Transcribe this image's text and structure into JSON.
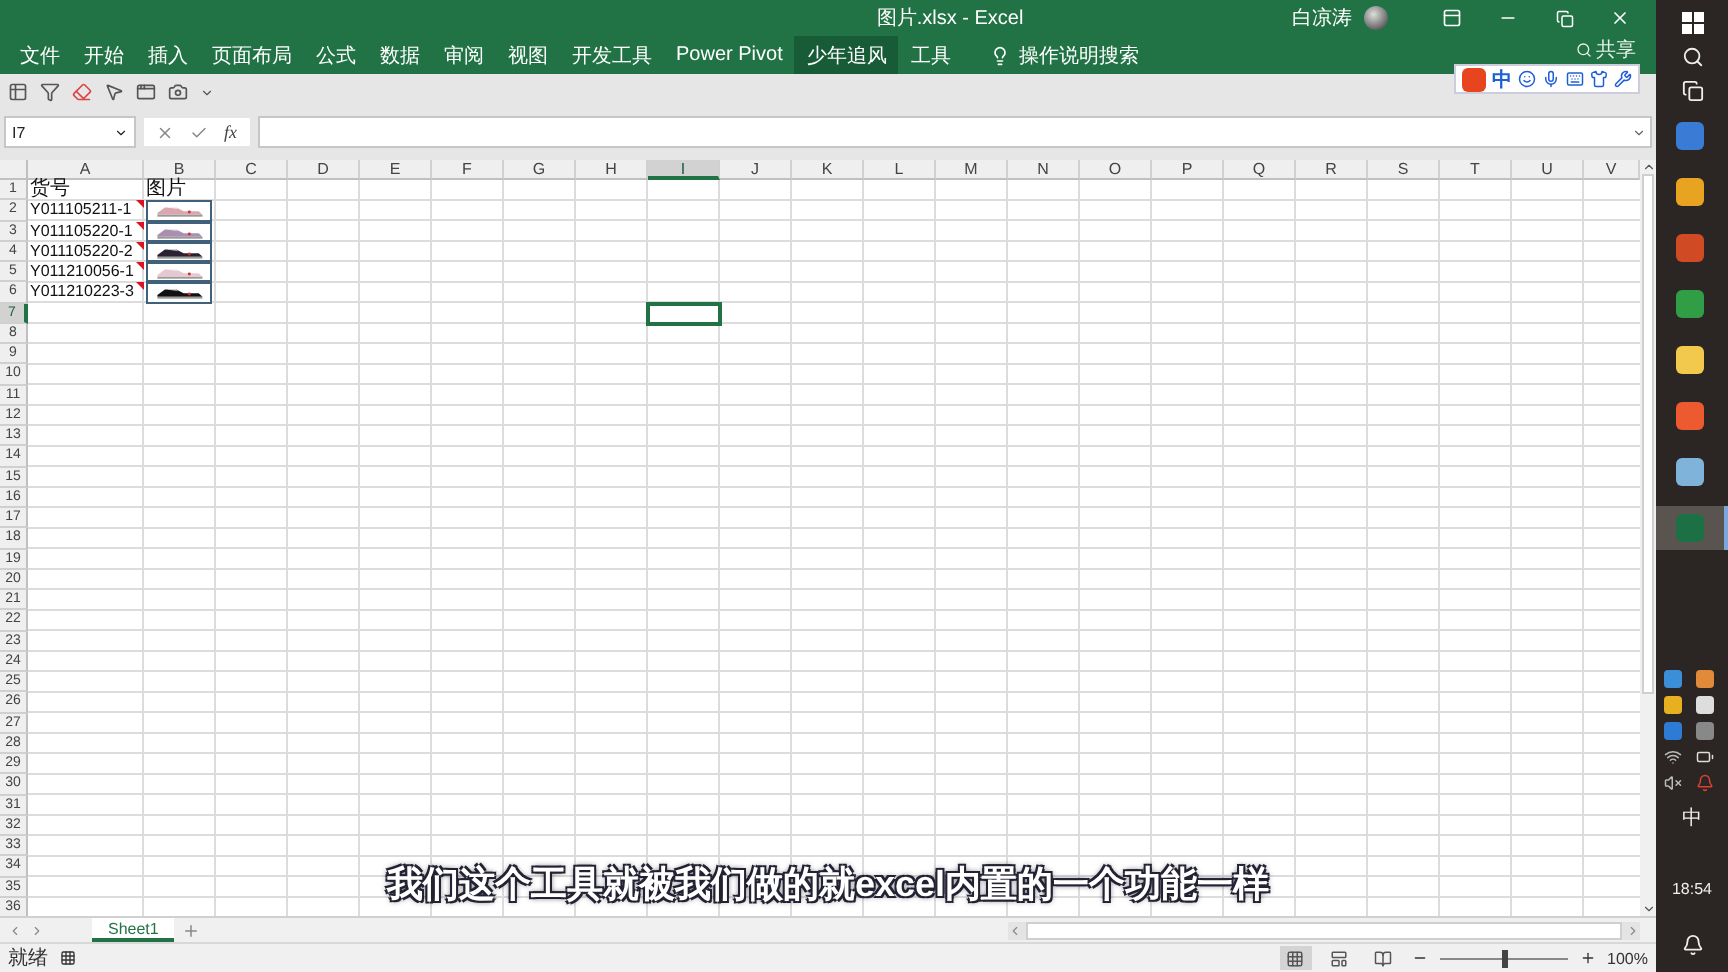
{
  "title_bar": {
    "title": "图片.xlsx  -  Excel",
    "user": "白凉涛"
  },
  "ribbon_tabs": [
    {
      "label": "文件",
      "selected": false
    },
    {
      "label": "开始",
      "selected": false
    },
    {
      "label": "插入",
      "selected": false
    },
    {
      "label": "页面布局",
      "selected": false
    },
    {
      "label": "公式",
      "selected": false
    },
    {
      "label": "数据",
      "selected": false
    },
    {
      "label": "审阅",
      "selected": false
    },
    {
      "label": "视图",
      "selected": false
    },
    {
      "label": "开发工具",
      "selected": false
    },
    {
      "label": "Power Pivot",
      "selected": false
    },
    {
      "label": "少年追风",
      "selected": true
    },
    {
      "label": "工具",
      "selected": false
    }
  ],
  "search_hint": "操作说明搜索",
  "share": "共享",
  "ime_toolbar": {
    "mode": "中"
  },
  "formula_bar": {
    "name_box": "I7",
    "function_button": "fx"
  },
  "sheet": {
    "columns": [
      {
        "label": "A",
        "selected": false
      },
      {
        "label": "B",
        "selected": false
      },
      {
        "label": "C",
        "selected": false
      },
      {
        "label": "D",
        "selected": false
      },
      {
        "label": "E",
        "selected": false
      },
      {
        "label": "F",
        "selected": false
      },
      {
        "label": "G",
        "selected": false
      },
      {
        "label": "H",
        "selected": false
      },
      {
        "label": "I",
        "selected": true
      },
      {
        "label": "J",
        "selected": false
      },
      {
        "label": "K",
        "selected": false
      },
      {
        "label": "L",
        "selected": false
      },
      {
        "label": "M",
        "selected": false
      },
      {
        "label": "N",
        "selected": false
      },
      {
        "label": "O",
        "selected": false
      },
      {
        "label": "P",
        "selected": false
      },
      {
        "label": "Q",
        "selected": false
      },
      {
        "label": "R",
        "selected": false
      },
      {
        "label": "S",
        "selected": false
      },
      {
        "label": "T",
        "selected": false
      },
      {
        "label": "U",
        "selected": false
      },
      {
        "label": "V",
        "selected": false
      }
    ],
    "rows": [
      {
        "label": "1",
        "selected": false,
        "cells": [
          {
            "kind": "text",
            "text": "货号",
            "has_comment": false
          },
          {
            "kind": "text",
            "text": "图片",
            "has_comment": false
          }
        ]
      },
      {
        "label": "2",
        "selected": false,
        "cells": [
          {
            "kind": "text",
            "text": "Y011105211-1",
            "has_comment": true
          },
          {
            "kind": "picture"
          }
        ]
      },
      {
        "label": "3",
        "selected": false,
        "cells": [
          {
            "kind": "text",
            "text": "Y011105220-1",
            "has_comment": true
          },
          {
            "kind": "picture"
          }
        ]
      },
      {
        "label": "4",
        "selected": false,
        "cells": [
          {
            "kind": "text",
            "text": "Y011105220-2",
            "has_comment": true
          },
          {
            "kind": "picture"
          }
        ]
      },
      {
        "label": "5",
        "selected": false,
        "cells": [
          {
            "kind": "text",
            "text": "Y011210056-1",
            "has_comment": true
          },
          {
            "kind": "picture"
          }
        ]
      },
      {
        "label": "6",
        "selected": false,
        "cells": [
          {
            "kind": "text",
            "text": "Y011210223-3",
            "has_comment": true
          },
          {
            "kind": "picture"
          }
        ]
      },
      {
        "label": "7",
        "selected": true
      },
      {
        "label": "8",
        "selected": false
      },
      {
        "label": "9",
        "selected": false
      },
      {
        "label": "10",
        "selected": false
      },
      {
        "label": "11",
        "selected": false
      },
      {
        "label": "12",
        "selected": false
      },
      {
        "label": "13",
        "selected": false
      },
      {
        "label": "14",
        "selected": false
      },
      {
        "label": "15",
        "selected": false
      },
      {
        "label": "16",
        "selected": false
      },
      {
        "label": "17",
        "selected": false
      },
      {
        "label": "18",
        "selected": false
      },
      {
        "label": "19",
        "selected": false
      },
      {
        "label": "20",
        "selected": false
      },
      {
        "label": "21",
        "selected": false
      },
      {
        "label": "22",
        "selected": false
      },
      {
        "label": "23",
        "selected": false
      },
      {
        "label": "24",
        "selected": false
      },
      {
        "label": "25",
        "selected": false
      },
      {
        "label": "26",
        "selected": false
      },
      {
        "label": "27",
        "selected": false
      },
      {
        "label": "28",
        "selected": false
      },
      {
        "label": "29",
        "selected": false
      },
      {
        "label": "30",
        "selected": false
      },
      {
        "label": "31",
        "selected": false
      },
      {
        "label": "32",
        "selected": false
      },
      {
        "label": "33",
        "selected": false
      },
      {
        "label": "34",
        "selected": false
      },
      {
        "label": "35",
        "selected": false
      },
      {
        "label": "36",
        "selected": false
      }
    ]
  },
  "sheet_tabs": [
    {
      "label": "Sheet1",
      "selected": true
    }
  ],
  "status_bar": {
    "mode": "就绪",
    "zoom": "100%",
    "zoom_slider": {
      "level": 0.5
    }
  },
  "subtitle": "我们这个工具就被我们做的就excel内置的一个功能一样",
  "taskbar": {
    "input_indicator": "中",
    "clock": "18:54"
  }
}
